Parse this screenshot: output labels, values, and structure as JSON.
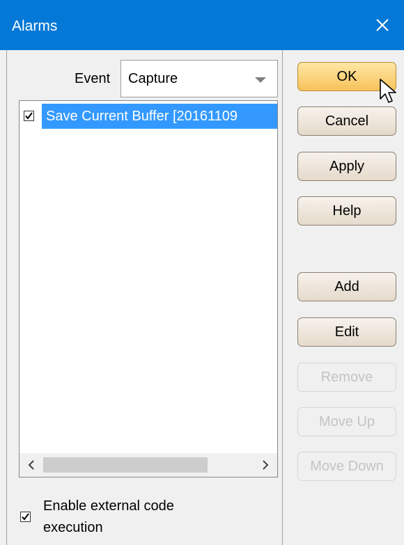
{
  "window": {
    "title": "Alarms",
    "close_icon": "close-icon",
    "titlebar_color": "#0478d7"
  },
  "event": {
    "label": "Event",
    "selected": "Capture"
  },
  "list": {
    "items": [
      {
        "label": "Save Current Buffer [20161109",
        "checked": true,
        "selected": true
      }
    ],
    "selection_color": "#3399ff"
  },
  "buttons": {
    "ok": "OK",
    "cancel": "Cancel",
    "apply": "Apply",
    "help": "Help",
    "add": "Add",
    "edit": "Edit",
    "remove": "Remove",
    "move_up": "Move Up",
    "move_down": "Move Down"
  },
  "options": {
    "enable_external_code": "Enable external code execution",
    "enable_external_code_checked": true
  },
  "colors": {
    "default_button": "#f7c25a",
    "disabled_text": "#c4c4c4"
  }
}
